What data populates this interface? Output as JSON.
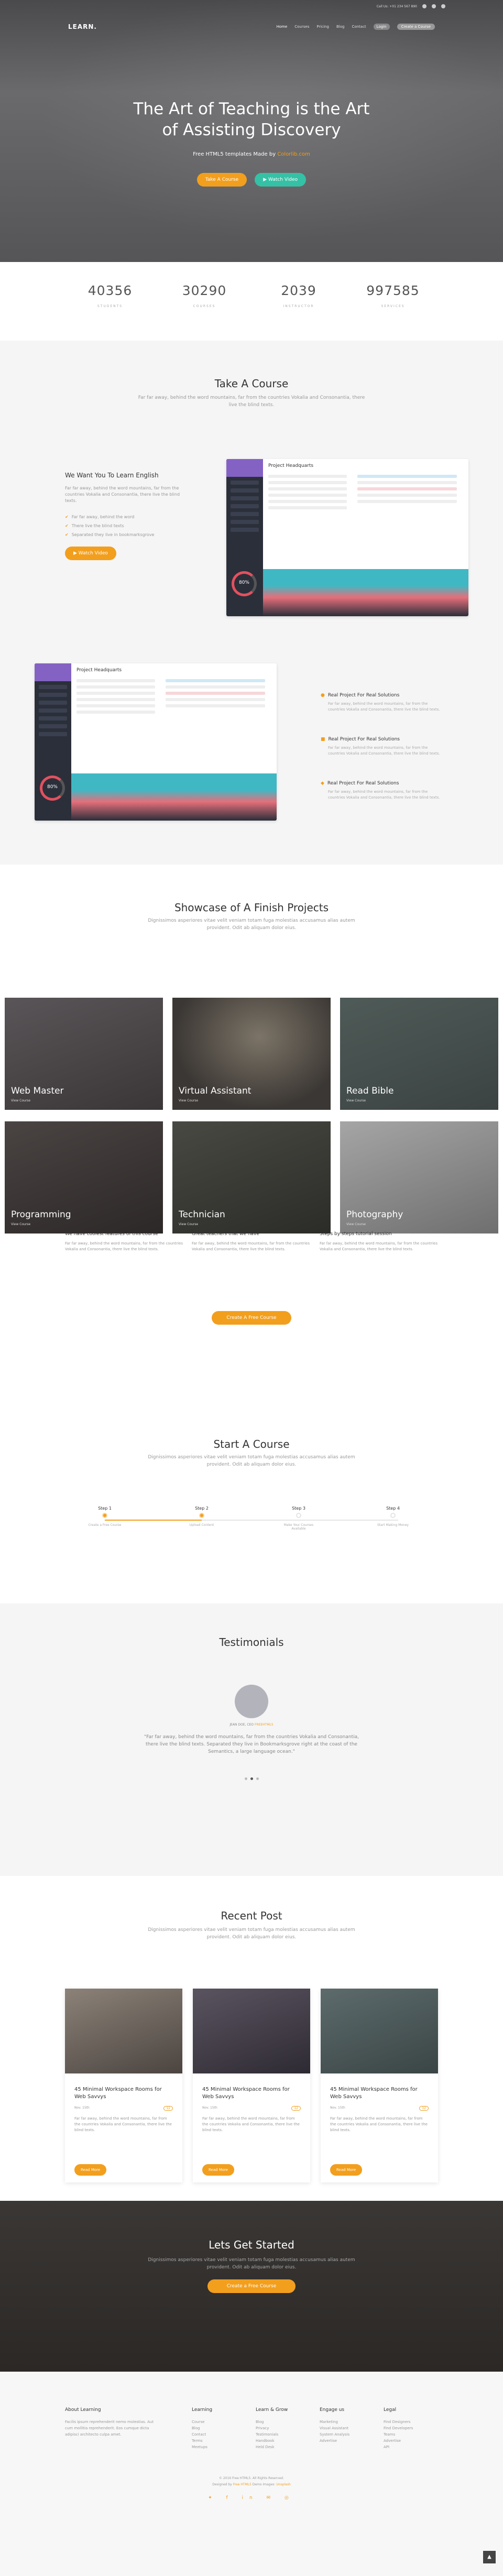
{
  "topbar": {
    "text": "Call Us: +01 234 567 890"
  },
  "brand": {
    "logo": "LEARN."
  },
  "nav": {
    "items": [
      "Home",
      "Courses",
      "Pricing",
      "Blog",
      "Contact"
    ],
    "login": "Login",
    "cta": "Create a Course"
  },
  "hero": {
    "title_line1": "The Art of Teaching is the Art",
    "title_line2": "of Assisting Discovery",
    "sub_prefix": "Free HTML5 templates Made by",
    "sub_link": "Colorlib.com",
    "btn_take": "Take A Course",
    "btn_video": "▶ Watch Video"
  },
  "stats": [
    {
      "num": "40356",
      "label": "STUDENTS"
    },
    {
      "num": "30290",
      "label": "COURSES"
    },
    {
      "num": "2039",
      "label": "INSTRUCTOR"
    },
    {
      "num": "997585",
      "label": "SERVICES"
    }
  ],
  "take": {
    "title": "Take A Course",
    "sub": "Far far away, behind the word mountains, far from the countries Vokalia and Consonantia, there live the blind texts.",
    "left_title": "We Want You To Learn English",
    "left_text": "Far far away, behind the word mountains, far from the countries Vokalia and Consonantia, there live the blind texts.",
    "list": [
      "Far far away, behind the word",
      "There live the blind texts",
      "Separated they live in bookmarksgrove"
    ],
    "btn": "▶ Watch Video",
    "dash_title": "Project Headquarts",
    "gauge": "80%",
    "right": [
      {
        "title": "Real Project For Real Solutions",
        "text": "Far far away, behind the word mountains, far from the countries Vokalia and Consonantia, there live the blind texts."
      },
      {
        "title": "Real Project For Real Solutions",
        "text": "Far far away, behind the word mountains, far from the countries Vokalia and Consonantia, there live the blind texts."
      },
      {
        "title": "Real Project For Real Solutions",
        "text": "Far far away, behind the word mountains, far from the countries Vokalia and Consonantia, there live the blind texts."
      }
    ]
  },
  "showcase": {
    "title": "Showcase of A Finish Projects",
    "sub": "Dignissimos asperiores vitae velit veniam totam fuga molestias accusamus alias autem provident. Odit ab aliquam dolor eius.",
    "tiles": [
      {
        "name": "Web Master",
        "sub": "View Course"
      },
      {
        "name": "Virtual Assistant",
        "sub": "View Course"
      },
      {
        "name": "Read Bible",
        "sub": "View Course"
      },
      {
        "name": "Programming",
        "sub": "View Course"
      },
      {
        "name": "Technician",
        "sub": "View Course"
      },
      {
        "name": "Photography",
        "sub": "View Course"
      }
    ],
    "features": [
      {
        "title": "We have coolest features of this course",
        "text": "Far far away, behind the word mountains, far from the countries Vokalia and Consonantia, there live the blind texts."
      },
      {
        "title": "Great teachers that we have",
        "text": "Far far away, behind the word mountains, far from the countries Vokalia and Consonantia, there live the blind texts."
      },
      {
        "title": "Steps by steps tutorial session",
        "text": "Far far away, behind the word mountains, far from the countries Vokalia and Consonantia, there live the blind texts."
      }
    ],
    "btn": "Create A Free Course"
  },
  "start": {
    "title": "Start A Course",
    "sub": "Dignissimos asperiores vitae velit veniam totam fuga molestias accusamus alias autem provident. Odit ab aliquam dolor eius.",
    "steps": [
      {
        "label": "Step 1",
        "desc": "Create a Free Course"
      },
      {
        "label": "Step 2",
        "desc": "Upload Content"
      },
      {
        "label": "Step 3",
        "desc": "Make Your Courses Available"
      },
      {
        "label": "Step 4",
        "desc": "Start Making Money"
      }
    ]
  },
  "testimonials": {
    "title": "Testimonials",
    "name": "JEAN DOE, CEO",
    "company": "FREEHTML5",
    "quote": "\"Far far away, behind the word mountains, far from the countries Vokalia and Consonantia, there live the blind texts. Separated they live in Bookmarksgrove right at the coast of the Semantics, a large language ocean.\""
  },
  "recent": {
    "title": "Recent Post",
    "sub": "Dignissimos asperiores vitae velit veniam totam fuga molestias accusamus alias autem provident. Odit ab aliquam dolor eius.",
    "posts": [
      {
        "title": "45 Minimal Workspace Rooms for Web Savvys",
        "date": "Nov. 15th",
        "count": "12",
        "text": "Far far away, behind the word mountains, far from the countries Vokalia and Consonantia, there live the blind texts.",
        "btn": "Read More"
      },
      {
        "title": "45 Minimal Workspace Rooms for Web Savvys",
        "date": "Nov. 15th",
        "count": "12",
        "text": "Far far away, behind the word mountains, far from the countries Vokalia and Consonantia, there live the blind texts.",
        "btn": "Read More"
      },
      {
        "title": "45 Minimal Workspace Rooms for Web Savvys",
        "date": "Nov. 15th",
        "count": "12",
        "text": "Far far away, behind the word mountains, far from the countries Vokalia and Consonantia, there live the blind texts.",
        "btn": "Read More"
      }
    ]
  },
  "cta": {
    "title": "Lets Get Started",
    "sub": "Dignissimos asperiores vitae velit veniam totam fuga molestias accusamus alias autem provident. Odit ab aliquam dolor eius.",
    "btn": "Create a Free Course"
  },
  "footer": {
    "about_title": "About Learning",
    "about_text": "Facilis ipsum reprehenderit nemo molestias. Aut cum mollitia reprehenderit. Eos cumque dicta adipisci architecto culpa amet.",
    "cols": [
      {
        "title": "Learning",
        "items": [
          "Course",
          "Blog",
          "Contact",
          "Terms",
          "Meetups"
        ]
      },
      {
        "title": "Learn & Grow",
        "items": [
          "Blog",
          "Privacy",
          "Testimonials",
          "Handbook",
          "Held Desk"
        ]
      },
      {
        "title": "Engage us",
        "items": [
          "Marketing",
          "Visual Assistant",
          "System Analysis",
          "Advertise"
        ]
      },
      {
        "title": "Legal",
        "items": [
          "Find Designers",
          "Find Developers",
          "Teams",
          "Advertise",
          "API"
        ]
      }
    ],
    "copy1": "© 2016 Free HTML5. All Rights Reserved.",
    "copy2": "Designed by",
    "copy2_link": "Free HTML5",
    "copy3": "Demo Images:",
    "copy3_link": "Unsplash",
    "social": "✦ f in ✉ ◎",
    "totop": "▲"
  }
}
